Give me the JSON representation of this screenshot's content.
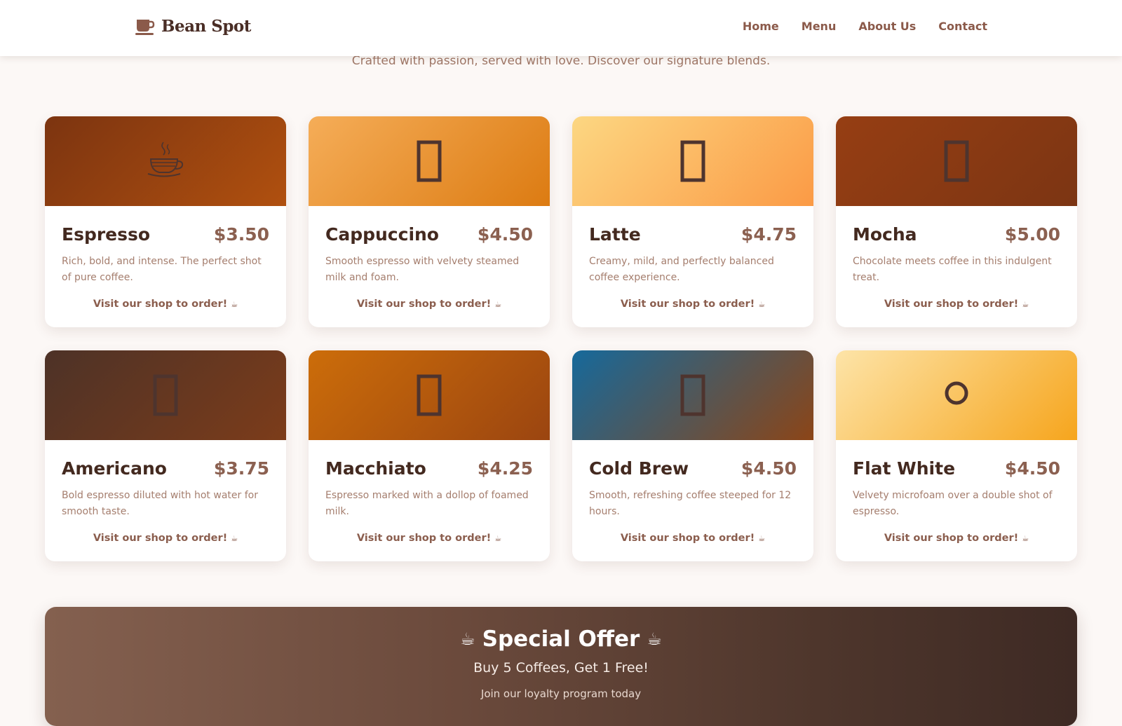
{
  "brand": {
    "name": "Bean Spot",
    "icon": "coffee-cup-icon",
    "color": "#8b5a4a"
  },
  "nav": {
    "items": [
      {
        "label": "Home"
      },
      {
        "label": "Menu"
      },
      {
        "label": "About Us"
      },
      {
        "label": "Contact"
      }
    ]
  },
  "hero": {
    "subtitle": "Crafted with passion, served with love. Discover our signature blends."
  },
  "menu": {
    "cta_text": "Visit our shop to order!",
    "cta_glyph": "☕",
    "items": [
      {
        "name": "Espresso",
        "price": "$3.50",
        "description": "Rich, bold, and intense. The perfect shot of pure coffee.",
        "icon": "steaming-cup-icon"
      },
      {
        "name": "Cappuccino",
        "price": "$4.50",
        "description": "Smooth espresso with velvety steamed milk and foam.",
        "icon": "missing-glyph-icon"
      },
      {
        "name": "Latte",
        "price": "$4.75",
        "description": "Creamy, mild, and perfectly balanced coffee experience.",
        "icon": "missing-glyph-icon"
      },
      {
        "name": "Mocha",
        "price": "$5.00",
        "description": "Chocolate meets coffee in this indulgent treat.",
        "icon": "missing-glyph-icon"
      },
      {
        "name": "Americano",
        "price": "$3.75",
        "description": "Bold espresso diluted with hot water for smooth taste.",
        "icon": "missing-glyph-icon"
      },
      {
        "name": "Macchiato",
        "price": "$4.25",
        "description": "Espresso marked with a dollop of foamed milk.",
        "icon": "missing-glyph-icon"
      },
      {
        "name": "Cold Brew",
        "price": "$4.50",
        "description": "Smooth, refreshing coffee steeped for 12 hours.",
        "icon": "missing-glyph-icon"
      },
      {
        "name": "Flat White",
        "price": "$4.50",
        "description": "Velvety microfoam over a double shot of espresso.",
        "icon": "circle-icon"
      }
    ]
  },
  "offer": {
    "title": "Special Offer",
    "title_glyph": "☕",
    "subtitle": "Buy 5 Coffees, Get 1 Free!",
    "note": "Join our loyalty program today"
  },
  "colors": {
    "background": "#fcf8f6",
    "heading": "#43291f",
    "price": "#8b6050",
    "text_muted": "#a57e6e",
    "card_gradients": [
      [
        "#7c3410",
        "#b0500f"
      ],
      [
        "#f5ad58",
        "#dc7b12"
      ],
      [
        "#fcd782",
        "#fb9a45"
      ],
      [
        "#963e13",
        "#7c3513"
      ],
      [
        "#4d3227",
        "#7c3c1a"
      ],
      [
        "#cc6d0a",
        "#9b4510"
      ],
      [
        "#16699b",
        "#8c4517"
      ],
      [
        "#fde4a8",
        "#f6a51d"
      ]
    ]
  }
}
